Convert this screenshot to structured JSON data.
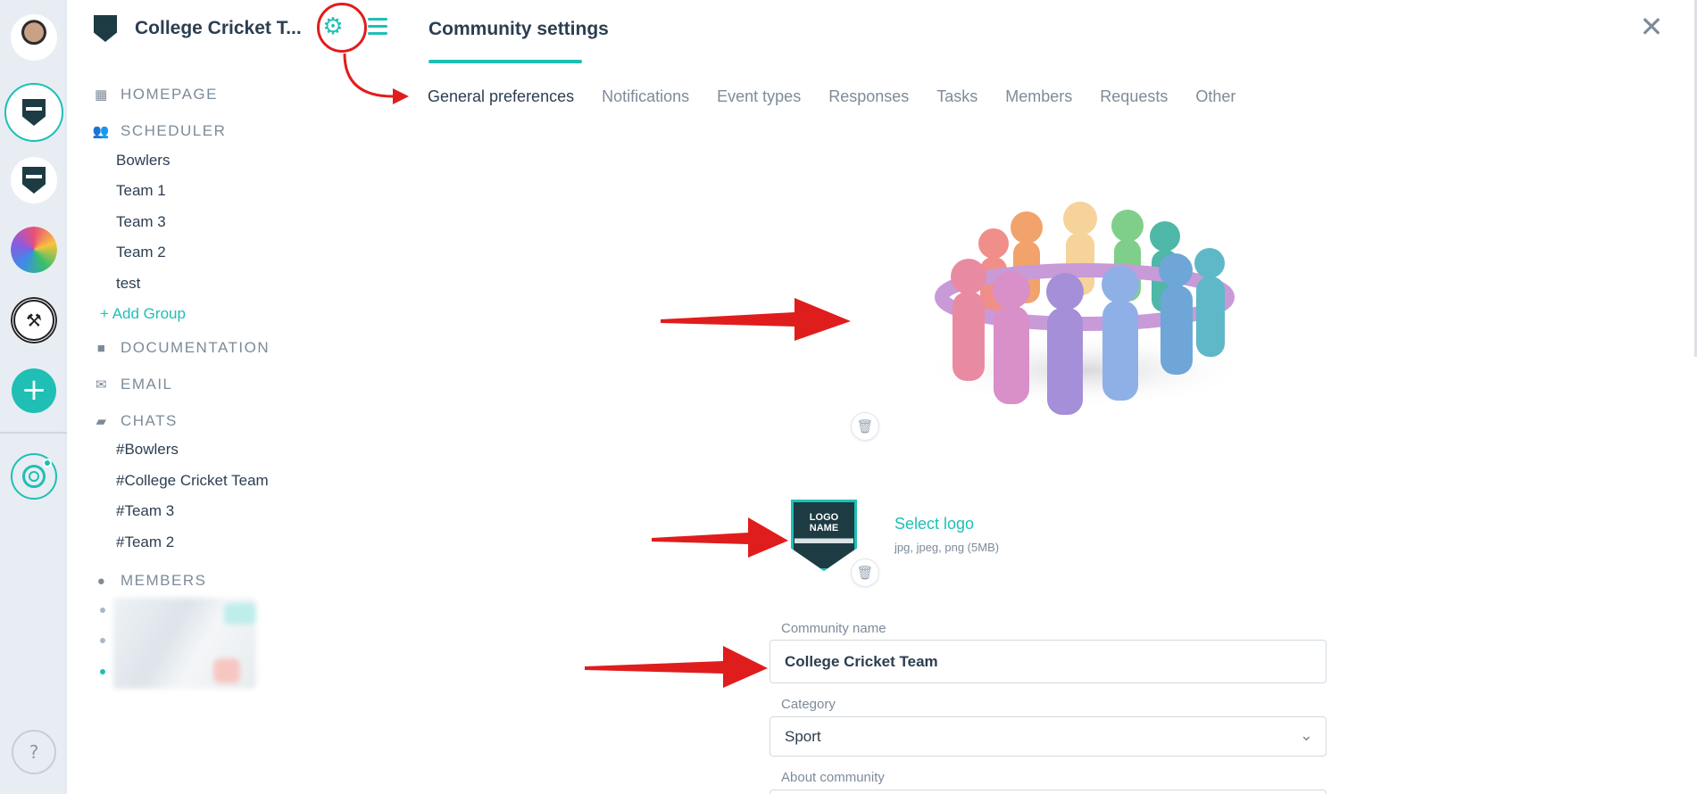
{
  "sidebar": {
    "title": "College Cricket T...",
    "sections": {
      "homepage": "HOMEPAGE",
      "scheduler": "SCHEDULER",
      "documentation": "DOCUMENTATION",
      "email": "EMAIL",
      "chats": "CHATS",
      "members": "MEMBERS"
    },
    "groups": [
      "Bowlers",
      "Team 1",
      "Team 3",
      "Team 2",
      "test"
    ],
    "add_group": "+ Add Group",
    "chats": [
      "#Bowlers",
      "#College Cricket Team",
      "#Team 3",
      "#Team 2"
    ]
  },
  "rail": {
    "add_symbol": "+",
    "help_symbol": "?"
  },
  "main": {
    "title": "Community settings",
    "close_symbol": "✕",
    "tabs": [
      "General preferences",
      "Notifications",
      "Event types",
      "Responses",
      "Tasks",
      "Members",
      "Requests",
      "Other"
    ],
    "active_tab": "General preferences",
    "logo": {
      "badge_text": "LOGO NAME",
      "select_label": "Select logo",
      "hint": "jpg, jpeg, png (5MB)"
    },
    "form": {
      "name_label": "Community name",
      "name_value": "College Cricket Team",
      "category_label": "Category",
      "category_value": "Sport",
      "about_label": "About community"
    }
  },
  "colors": {
    "accent": "#1fbfb5",
    "annotation": "#e01d1d",
    "text": "#2c3e50",
    "muted": "#7d8b99"
  },
  "icons": {
    "homepage": "dashboard-icon",
    "scheduler": "people-icon",
    "documentation": "folder-icon",
    "email": "envelope-icon",
    "chats": "chat-bubble-icon",
    "members": "person-icon",
    "settings": "gear-icon",
    "menu": "hamburger-icon",
    "close": "close-icon",
    "delete": "trash-icon",
    "dropdown": "chevron-down-icon"
  }
}
